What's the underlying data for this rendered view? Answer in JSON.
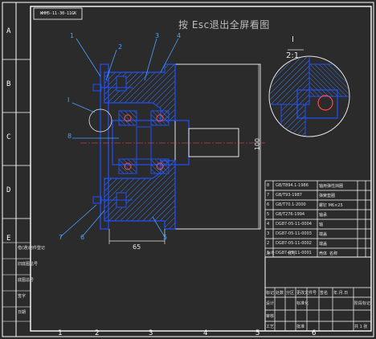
{
  "viewer": {
    "overlay_hint": "按 Esc退出全屏看图"
  },
  "drawing": {
    "code_box": "WHH5-11-30-11GK",
    "detail_title": "I",
    "detail_scale": "2:1",
    "balloons": [
      "1",
      "2",
      "3",
      "4",
      "I",
      "8",
      "7",
      "6",
      "5"
    ],
    "dim_height": "100",
    "dim_width": "65",
    "zones_left": [
      "A",
      "B",
      "C",
      "D",
      "E"
    ],
    "zones_bottom": [
      "1",
      "2",
      "3",
      "4",
      "5",
      "6",
      "7",
      "8",
      "9"
    ],
    "zones_top": [
      "2",
      "3",
      "4",
      "5",
      "6",
      "7",
      "8",
      "9"
    ],
    "colors": {
      "part": "#1f4fff",
      "hatch": "#3a7bff",
      "frame": "#ffffff",
      "dim": "#e6e6e6",
      "leader": "#4aa0ff",
      "background": "#2b2b2b"
    }
  },
  "bom": {
    "rows": [
      {
        "no": "8",
        "code": "GB/T894.1-1986",
        "name": "轴用弹性挡圈"
      },
      {
        "no": "7",
        "code": "GB/T93-1987",
        "name": "弹簧垫圈"
      },
      {
        "no": "6",
        "code": "GB/T70.1-2000",
        "name": "螺钉 M6×25"
      },
      {
        "no": "5",
        "code": "GB/T276-1994",
        "name": "轴承"
      },
      {
        "no": "4",
        "code": "DG87-05-11-0004",
        "name": "轴"
      },
      {
        "no": "3",
        "code": "DG87-05-11-0003",
        "name": "端盖"
      },
      {
        "no": "2",
        "code": "DG87-05-11-0002",
        "name": "端盖"
      },
      {
        "no": "1",
        "code": "DG87-05-11-0001",
        "name": "壳体"
      }
    ],
    "header": {
      "no": "序号",
      "code": "代号",
      "name": "名称"
    },
    "title_block": {
      "row1": [
        "标记",
        "处数",
        "分区",
        "更改文件号",
        "签名",
        "年.月.日"
      ],
      "row2": [
        "设计",
        "",
        "标准化",
        "",
        "阶段标记"
      ],
      "row3": [
        "审核"
      ],
      "row4": [
        "工艺",
        "",
        "批准",
        "",
        "共 1 张"
      ]
    }
  },
  "left_strip": [
    "借(通)用件登记",
    "旧底图总号",
    "底图总号",
    "签字",
    "日期"
  ]
}
